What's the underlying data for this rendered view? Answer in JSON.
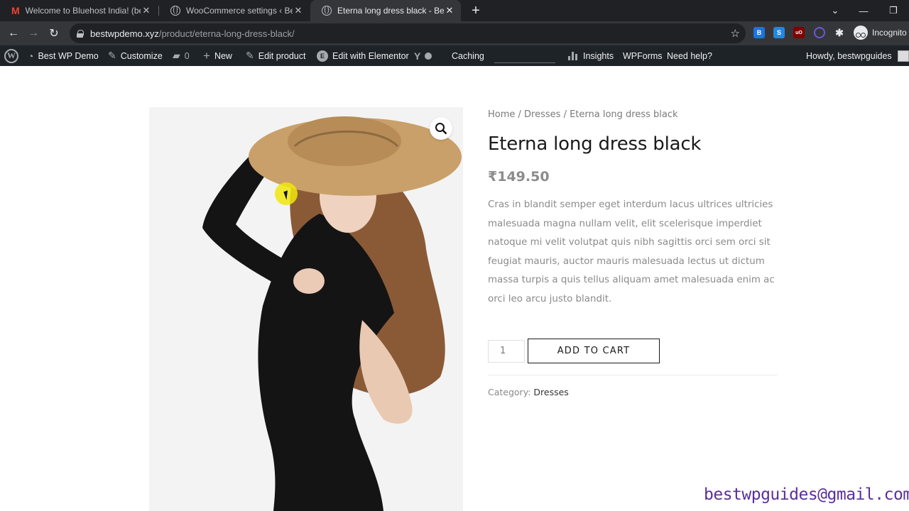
{
  "browser": {
    "tabs": [
      {
        "title": "Welcome to Bluehost India! (bes",
        "icon": "gmail-icon",
        "active": false
      },
      {
        "title": "WooCommerce settings ‹ Best W",
        "icon": "globe-icon",
        "active": false
      },
      {
        "title": "Eterna long dress black - Best W",
        "icon": "globe-icon",
        "active": true
      }
    ],
    "url_host": "bestwpdemo.xyz",
    "url_path": "/product/eterna-long-dress-black/",
    "profile_label": "Incognito",
    "extensions": [
      {
        "label": "B",
        "color": "#1a73e8",
        "badge": "4"
      },
      {
        "label": "S",
        "color": "#1e88e5"
      },
      {
        "label": "uO",
        "color": "#800000"
      },
      {
        "label": "",
        "color": "#6a5acd"
      }
    ]
  },
  "adminbar": {
    "site_name": "Best WP Demo",
    "customize": "Customize",
    "comments_count": "0",
    "new": "New",
    "edit_product": "Edit product",
    "edit_elementor": "Edit with Elementor",
    "caching": "Caching",
    "insights": "Insights",
    "wpforms": "WPForms",
    "need_help": "Need help?",
    "howdy": "Howdy, bestwpguides"
  },
  "product": {
    "breadcrumb": {
      "home": "Home",
      "sep": " / ",
      "category": "Dresses",
      "current": "Eterna long dress black"
    },
    "title": "Eterna long dress black",
    "price": "₹149.50",
    "description": "Cras in blandit semper eget interdum lacus ultrices ultricies malesuada magna nullam velit, elit scelerisque imperdiet natoque mi velit volutpat quis nibh sagittis orci sem orci sit feugiat mauris, auctor mauris malesuada lectus ut dictum massa turpis a quis tellus aliquam amet malesuada enim ac orci leo arcu justo blandit.",
    "quantity": "1",
    "add_to_cart": "ADD TO CART",
    "category_label": "Category:",
    "category_value": "Dresses",
    "image_subject": "woman in straw hat and black long dress"
  },
  "watermark": "bestwpguides@gmail.com"
}
